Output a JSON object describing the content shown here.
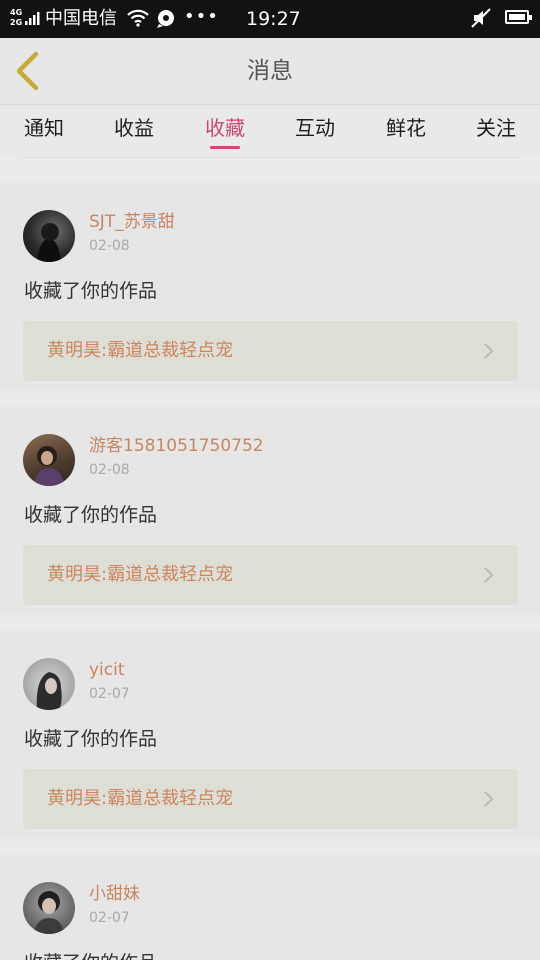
{
  "status_bar": {
    "network": "4G\n2G",
    "carrier": "中国电信",
    "dots": "•••",
    "time": "19:27"
  },
  "header": {
    "title": "消息"
  },
  "tabs": [
    {
      "label": "通知"
    },
    {
      "label": "收益"
    },
    {
      "label": "收藏"
    },
    {
      "label": "互动"
    },
    {
      "label": "鲜花"
    },
    {
      "label": "关注"
    }
  ],
  "active_tab": "收藏",
  "colors": {
    "accent": "#c94a72",
    "username": "#c88560",
    "work_title": "#cf845a"
  },
  "notifications": [
    {
      "username": "SJT_苏景甜",
      "date": "02-08",
      "action": "收藏了你的作品",
      "work": "黄明昊:霸道总裁轻点宠"
    },
    {
      "username": "游客1581051750752",
      "date": "02-08",
      "action": "收藏了你的作品",
      "work": "黄明昊:霸道总裁轻点宠"
    },
    {
      "username": "yicit",
      "date": "02-07",
      "action": "收藏了你的作品",
      "work": "黄明昊:霸道总裁轻点宠"
    },
    {
      "username": "小甜妹",
      "date": "02-07",
      "action": "收藏了你的作品",
      "work": ""
    }
  ]
}
